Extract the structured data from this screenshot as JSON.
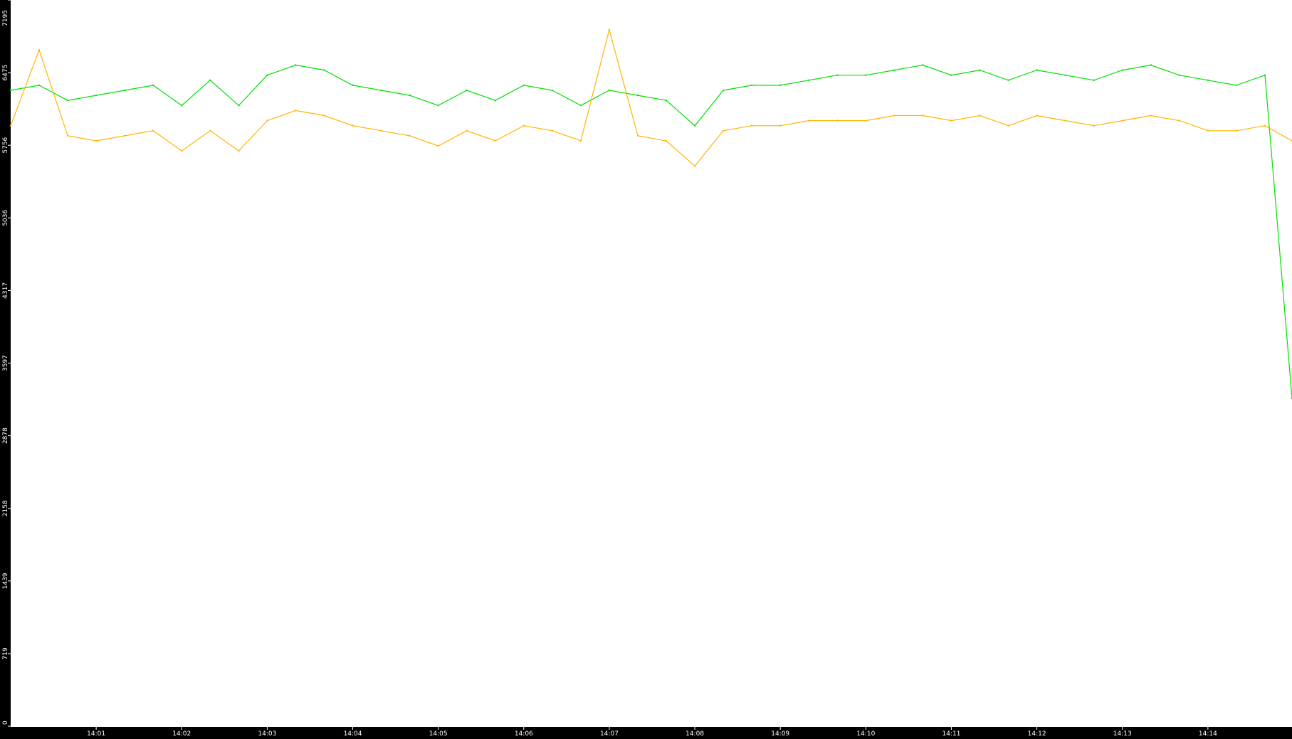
{
  "chart_data": {
    "type": "line",
    "title": "",
    "xlabel": "",
    "ylabel": "",
    "ylim": [
      0,
      7195
    ],
    "xlim": [
      "14:00:00",
      "14:14:59"
    ],
    "y_ticks": [
      0,
      719,
      1439,
      2158,
      2878,
      3597,
      4317,
      5036,
      5756,
      6475,
      7195
    ],
    "y_tick_labels": [
      "0",
      "719",
      "1439",
      "2158",
      "2878",
      "3597",
      "4317",
      "5036",
      "5756",
      "6475",
      "7195"
    ],
    "x_ticks": [
      "14:01",
      "14:02",
      "14:03",
      "14:04",
      "14:05",
      "14:06",
      "14:07",
      "14:08",
      "14:09",
      "14:10",
      "14:11",
      "14:12",
      "14:13",
      "14:14"
    ],
    "grid": false,
    "legend": "none",
    "colors": {
      "background": "#ffffff",
      "axis_strip": "#000000",
      "tick_text": "#ffffff",
      "series_green": "#00e000",
      "series_orange": "#ffb400"
    },
    "series": [
      {
        "color": "#00e000",
        "x": [
          "14:00:00",
          "14:00:20",
          "14:00:40",
          "14:01:00",
          "14:01:20",
          "14:01:40",
          "14:02:00",
          "14:02:20",
          "14:02:40",
          "14:03:00",
          "14:03:20",
          "14:03:40",
          "14:04:00",
          "14:04:20",
          "14:04:40",
          "14:05:00",
          "14:05:20",
          "14:05:40",
          "14:06:00",
          "14:06:20",
          "14:06:40",
          "14:07:00",
          "14:07:20",
          "14:07:40",
          "14:08:00",
          "14:08:20",
          "14:08:40",
          "14:09:00",
          "14:09:20",
          "14:09:40",
          "14:10:00",
          "14:10:20",
          "14:10:40",
          "14:11:00",
          "14:11:20",
          "14:11:40",
          "14:12:00",
          "14:12:20",
          "14:12:40",
          "14:13:00",
          "14:13:20",
          "14:13:40",
          "14:14:00",
          "14:14:20",
          "14:14:40",
          "14:14:59"
        ],
        "values": [
          6300,
          6350,
          6200,
          6250,
          6300,
          6350,
          6150,
          6400,
          6150,
          6450,
          6550,
          6500,
          6350,
          6300,
          6250,
          6150,
          6300,
          6200,
          6350,
          6300,
          6150,
          6300,
          6250,
          6200,
          5950,
          6300,
          6350,
          6350,
          6400,
          6450,
          6450,
          6500,
          6550,
          6450,
          6500,
          6400,
          6500,
          6450,
          6400,
          6500,
          6550,
          6450,
          6400,
          6350,
          6450,
          3250
        ]
      },
      {
        "color": "#ffb400",
        "x": [
          "14:00:00",
          "14:00:20",
          "14:00:40",
          "14:01:00",
          "14:01:20",
          "14:01:40",
          "14:02:00",
          "14:02:20",
          "14:02:40",
          "14:03:00",
          "14:03:20",
          "14:03:40",
          "14:04:00",
          "14:04:20",
          "14:04:40",
          "14:05:00",
          "14:05:20",
          "14:05:40",
          "14:06:00",
          "14:06:20",
          "14:06:40",
          "14:07:00",
          "14:07:20",
          "14:07:40",
          "14:08:00",
          "14:08:20",
          "14:08:40",
          "14:09:00",
          "14:09:20",
          "14:09:40",
          "14:10:00",
          "14:10:20",
          "14:10:40",
          "14:11:00",
          "14:11:20",
          "14:11:40",
          "14:12:00",
          "14:12:20",
          "14:12:40",
          "14:13:00",
          "14:13:20",
          "14:13:40",
          "14:14:00",
          "14:14:20",
          "14:14:40",
          "14:14:59"
        ],
        "values": [
          5950,
          6700,
          5850,
          5800,
          5850,
          5900,
          5700,
          5900,
          5700,
          6000,
          6100,
          6050,
          5950,
          5900,
          5850,
          5750,
          5900,
          5800,
          5950,
          5900,
          5800,
          6900,
          5850,
          5800,
          5550,
          5900,
          5950,
          5950,
          6000,
          6000,
          6000,
          6050,
          6050,
          6000,
          6050,
          5950,
          6050,
          6000,
          5950,
          6000,
          6050,
          6000,
          5900,
          5900,
          5950,
          5800
        ]
      }
    ]
  }
}
